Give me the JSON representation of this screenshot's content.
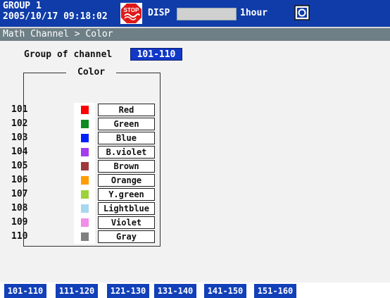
{
  "header": {
    "group_name": "GROUP 1",
    "datetime": "2005/10/17 09:18:02",
    "stop_icon_text": "STOP",
    "disp_label": "DISP",
    "interval": "1hour"
  },
  "breadcrumb": "Math Channel > Color",
  "group_of_channel": {
    "label": "Group of channel",
    "value": "101-110"
  },
  "color_section": {
    "title": "Color",
    "rows": [
      {
        "num": "101",
        "color": "#ff0000",
        "name": "Red"
      },
      {
        "num": "102",
        "color": "#0e8a1e",
        "name": "Green"
      },
      {
        "num": "103",
        "color": "#0020ff",
        "name": "Blue"
      },
      {
        "num": "104",
        "color": "#a43cf0",
        "name": "B.violet"
      },
      {
        "num": "105",
        "color": "#a0383a",
        "name": "Brown"
      },
      {
        "num": "106",
        "color": "#ff9d00",
        "name": "Orange"
      },
      {
        "num": "107",
        "color": "#9ed23a",
        "name": "Y.green"
      },
      {
        "num": "108",
        "color": "#a8d8ee",
        "name": "Lightblue"
      },
      {
        "num": "109",
        "color": "#f08ee8",
        "name": "Violet"
      },
      {
        "num": "110",
        "color": "#808080",
        "name": "Gray"
      }
    ]
  },
  "tabs": [
    "101-110",
    "111-120",
    "121-130",
    "131-140",
    "141-150",
    "151-160"
  ]
}
